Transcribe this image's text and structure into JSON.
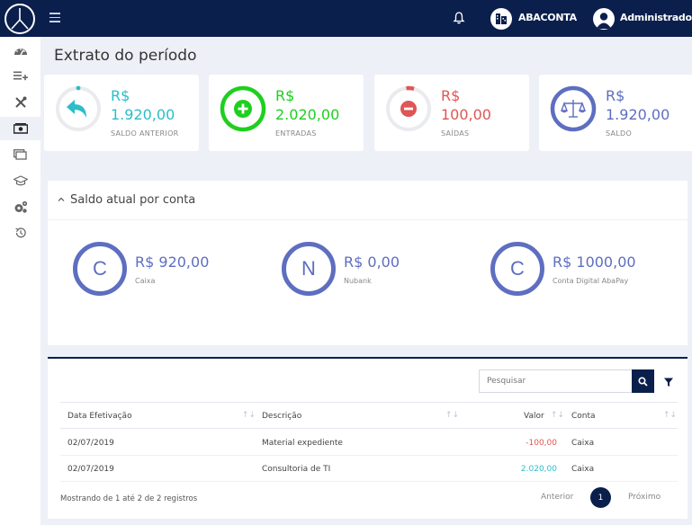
{
  "topbar": {
    "company_label": "ABACONTA",
    "user_label": "Administrador"
  },
  "sidebar": {
    "items": [
      {
        "icon": "dashboard-icon"
      },
      {
        "icon": "list-add-icon"
      },
      {
        "icon": "tools-icon"
      },
      {
        "icon": "money-icon",
        "active": true
      },
      {
        "icon": "window-icon"
      },
      {
        "icon": "graduation-cap-icon"
      },
      {
        "icon": "gears-icon"
      },
      {
        "icon": "history-icon"
      }
    ]
  },
  "page_title": "Extrato do período",
  "stats": [
    {
      "currency": "R$",
      "amount": "1.920,00",
      "label": "SALDO ANTERIOR",
      "color": "#2bbdc9",
      "icon": "reply-arrow-icon"
    },
    {
      "currency": "R$",
      "amount": "2.020,00",
      "label": "ENTRADAS",
      "color": "#1ecf1e",
      "icon": "plus-circle-icon"
    },
    {
      "currency": "R$",
      "amount": "100,00",
      "label": "SAÍDAS",
      "color": "#e05555",
      "icon": "minus-circle-icon"
    },
    {
      "currency": "R$",
      "amount": "1.920,00",
      "label": "SALDO",
      "color": "#5e6ec0",
      "icon": "balance-scale-icon"
    }
  ],
  "saldo": {
    "title": "Saldo atual por conta",
    "accounts": [
      {
        "initial": "C",
        "value": "R$ 920,00",
        "name": "Caixa"
      },
      {
        "initial": "N",
        "value": "R$ 0,00",
        "name": "Nubank"
      },
      {
        "initial": "C",
        "value": "R$ 1000,00",
        "name": "Conta Digital AbaPay"
      }
    ]
  },
  "table": {
    "search_placeholder": "Pesquisar",
    "columns": [
      "Data Efetivação",
      "Descrição",
      "Valor",
      "Conta"
    ],
    "rows": [
      {
        "date": "02/07/2019",
        "description": "Material expediente",
        "value": "-100,00",
        "value_color": "#e05555",
        "account": "Caixa"
      },
      {
        "date": "02/07/2019",
        "description": "Consultoria de TI",
        "value": "2.020,00",
        "value_color": "#2bbdc9",
        "account": "Caixa"
      }
    ],
    "footer_info": "Mostrando de 1 até 2 de 2 registros",
    "pagination": {
      "prev": "Anterior",
      "current": "1",
      "next": "Próximo"
    }
  }
}
